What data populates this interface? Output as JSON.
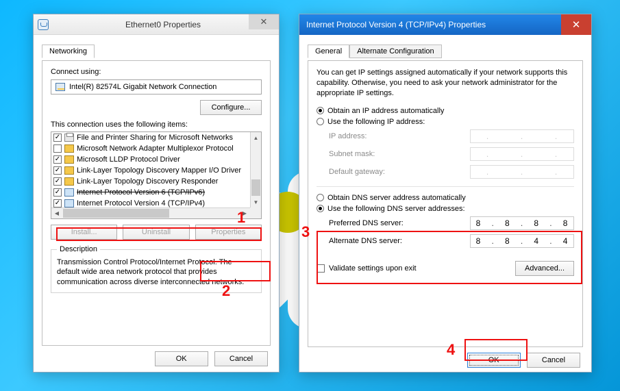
{
  "left": {
    "title": "Ethernet0 Properties",
    "tab": "Networking",
    "connect_using_label": "Connect using:",
    "adapter": "Intel(R) 82574L Gigabit Network Connection",
    "configure_btn": "Configure...",
    "items_label": "This connection uses the following items:",
    "items": [
      {
        "checked": true,
        "icon": "printer",
        "text": "File and Printer Sharing for Microsoft Networks"
      },
      {
        "checked": false,
        "icon": "nic",
        "text": "Microsoft Network Adapter Multiplexor Protocol"
      },
      {
        "checked": true,
        "icon": "nic",
        "text": "Microsoft LLDP Protocol Driver"
      },
      {
        "checked": true,
        "icon": "nic",
        "text": "Link-Layer Topology Discovery Mapper I/O Driver"
      },
      {
        "checked": true,
        "icon": "nic",
        "text": "Link-Layer Topology Discovery Responder"
      },
      {
        "checked": true,
        "icon": "stack",
        "text": "Internet Protocol Version 6 (TCP/IPv6)",
        "strike": true
      },
      {
        "checked": true,
        "icon": "stack",
        "text": "Internet Protocol Version 4 (TCP/IPv4)",
        "selected": true
      }
    ],
    "install_btn": "Install...",
    "uninstall_btn": "Uninstall",
    "properties_btn": "Properties",
    "desc_legend": "Description",
    "desc_text": "Transmission Control Protocol/Internet Protocol. The default wide area network protocol that provides communication across diverse interconnected networks.",
    "ok": "OK",
    "cancel": "Cancel"
  },
  "right": {
    "title": "Internet Protocol Version 4 (TCP/IPv4) Properties",
    "tab_general": "General",
    "tab_alt": "Alternate Configuration",
    "intro": "You can get IP settings assigned automatically if your network supports this capability. Otherwise, you need to ask your network administrator for the appropriate IP settings.",
    "ip_auto": "Obtain an IP address automatically",
    "ip_manual": "Use the following IP address:",
    "ip_address_lbl": "IP address:",
    "subnet_lbl": "Subnet mask:",
    "gateway_lbl": "Default gateway:",
    "dns_auto": "Obtain DNS server address automatically",
    "dns_manual": "Use the following DNS server addresses:",
    "pref_dns_lbl": "Preferred DNS server:",
    "alt_dns_lbl": "Alternate DNS server:",
    "pref_dns": [
      "8",
      "8",
      "8",
      "8"
    ],
    "alt_dns": [
      "8",
      "8",
      "4",
      "4"
    ],
    "validate": "Validate settings upon exit",
    "advanced": "Advanced...",
    "ok": "OK",
    "cancel": "Cancel"
  },
  "annotations": {
    "n1": "1",
    "n2": "2",
    "n3": "3",
    "n4": "4"
  }
}
